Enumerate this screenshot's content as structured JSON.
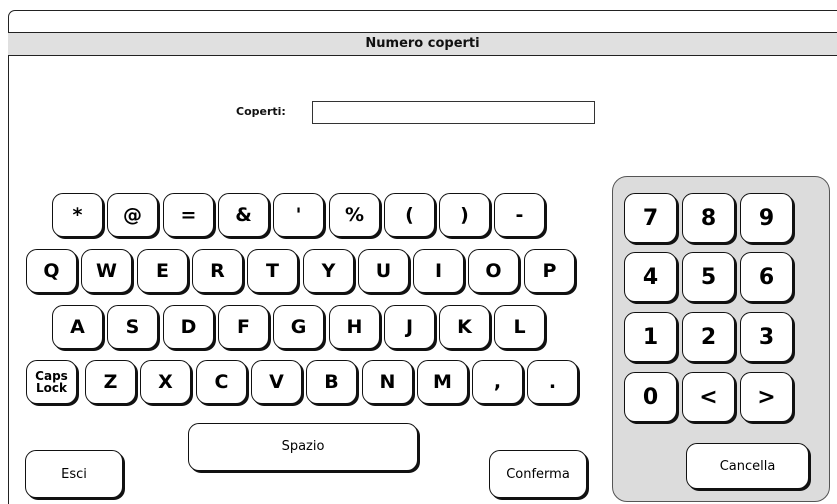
{
  "dialog": {
    "title": "Numero coperti",
    "field_label": "Coperti:",
    "field_value": "",
    "field_placeholder": ""
  },
  "keyboard": {
    "symbol_row": [
      "*",
      "@",
      "=",
      "&",
      "'",
      "%",
      "(",
      ")",
      "-"
    ],
    "row_q": [
      "Q",
      "W",
      "E",
      "R",
      "T",
      "Y",
      "U",
      "I",
      "O",
      "P"
    ],
    "row_a": [
      "A",
      "S",
      "D",
      "F",
      "G",
      "H",
      "J",
      "K",
      "L"
    ],
    "caps_lock": "Caps\nLock",
    "row_z": [
      "Z",
      "X",
      "C",
      "V",
      "B",
      "N",
      "M",
      ",",
      "."
    ],
    "space": "Spazio"
  },
  "numpad": {
    "rows": [
      [
        "7",
        "8",
        "9"
      ],
      [
        "4",
        "5",
        "6"
      ],
      [
        "1",
        "2",
        "3"
      ],
      [
        "0",
        "<",
        ">"
      ]
    ],
    "clear": "Cancella"
  },
  "actions": {
    "exit": "Esci",
    "confirm": "Conferma"
  },
  "colors": {
    "titlebar_bg": "#e0e0e0",
    "numpad_bg": "#dcdcdc",
    "key_bg": "#ffffff",
    "border": "#111111"
  }
}
